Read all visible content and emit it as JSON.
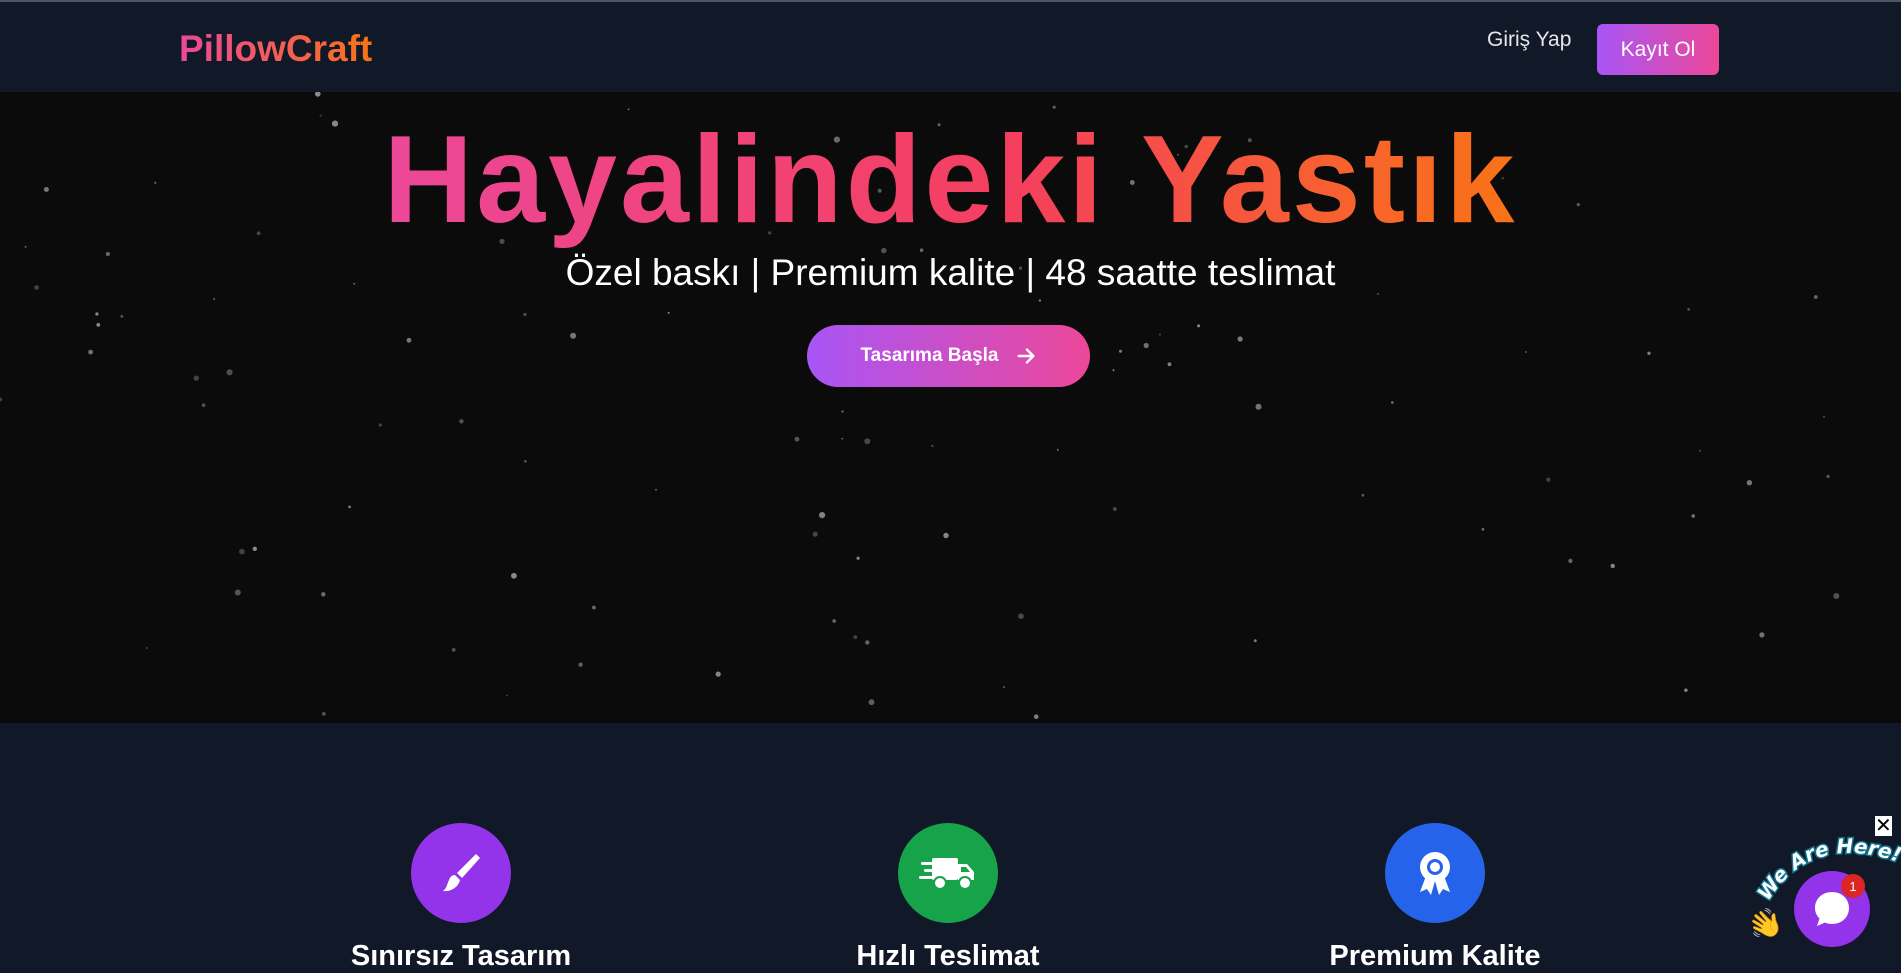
{
  "header": {
    "logo": "PillowCraft",
    "login_label": "Giriş Yap",
    "register_label": "Kayıt Ol"
  },
  "hero": {
    "title": "Hayalindeki Yastık",
    "subtitle": "Özel baskı | Premium kalite | 48 saatte teslimat",
    "cta_label": "Tasarıma Başla"
  },
  "features": [
    {
      "title": "Sınırsız Tasarım",
      "icon": "paintbrush-icon",
      "color": "#9333ea"
    },
    {
      "title": "Hızlı Teslimat",
      "icon": "delivery-truck-icon",
      "color": "#16a34a"
    },
    {
      "title": "Premium Kalite",
      "icon": "award-ribbon-icon",
      "color": "#2563eb"
    }
  ],
  "chat_widget": {
    "tagline": "We Are Here!",
    "badge_count": "1",
    "close_symbol": "✕"
  },
  "colors": {
    "brand_pink": "#ec4899",
    "brand_orange": "#f97316",
    "brand_purple": "#a855f7",
    "header_bg": "#111827",
    "hero_bg": "#0b0b0c"
  }
}
